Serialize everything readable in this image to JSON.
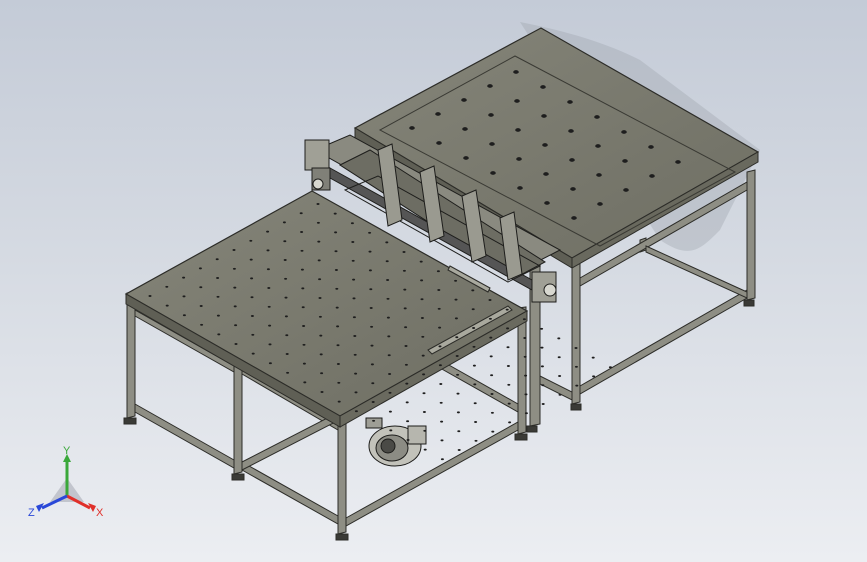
{
  "viewport": {
    "background_top": "#c4cbd7",
    "background_bottom": "#eceef2"
  },
  "model": {
    "panel_color": "#7a7a6e",
    "panel_edge": "#2c2c28",
    "frame_color": "#8e8e84",
    "hole_color": "#1e1e1e"
  },
  "triad": {
    "x_label": "X",
    "y_label": "Y",
    "z_label": "Z",
    "x_color": "#e0302a",
    "y_color": "#3aa83a",
    "z_color": "#2a48d8"
  }
}
